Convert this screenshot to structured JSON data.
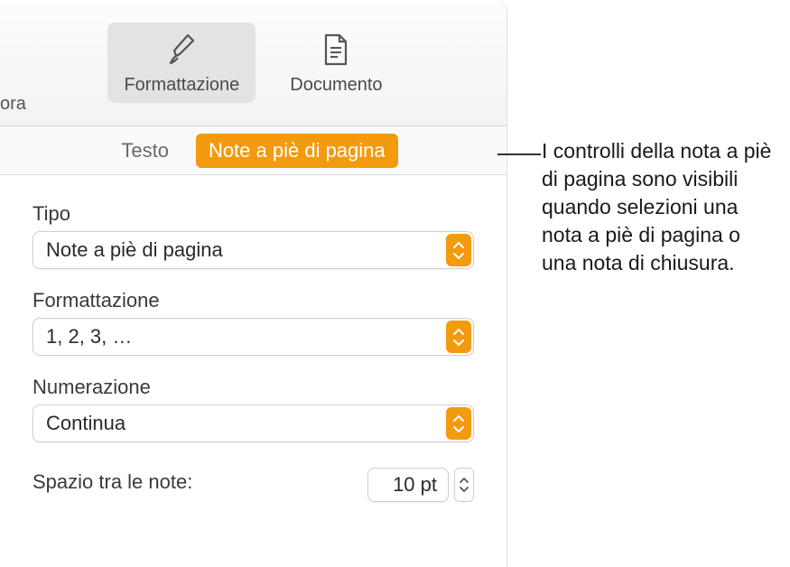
{
  "toolbar": {
    "left_partial": "ora",
    "format_label": "Formattazione",
    "document_label": "Documento"
  },
  "subtabs": {
    "text_label": "Testo",
    "footnotes_label": "Note a piè di pagina"
  },
  "controls": {
    "type_label": "Tipo",
    "type_value": "Note a piè di pagina",
    "format_label": "Formattazione",
    "format_value": "1, 2, 3, …",
    "numbering_label": "Numerazione",
    "numbering_value": "Continua",
    "spacing_label": "Spazio tra le note:",
    "spacing_value": "10 pt"
  },
  "callout": {
    "text": "I controlli della nota a piè di pagina sono visibili quando selezioni una nota a piè di pagina o una nota di chiusura."
  }
}
